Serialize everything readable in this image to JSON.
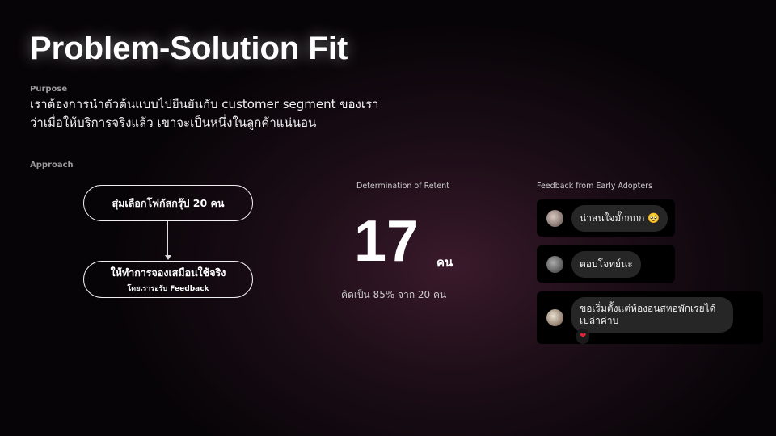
{
  "title": "Problem-Solution Fit",
  "purpose": {
    "label": "Purpose",
    "line1": "เราต้องการนำตัวต้นแบบไปยืนยันกับ customer segment ของเรา",
    "line2": "ว่าเมื่อให้บริการจริงแล้ว เขาจะเป็นหนึ่งในลูกค้าแน่นอน"
  },
  "approach": {
    "label": "Approach",
    "step1": "สุ่มเลือกโฟกัสกรุ๊ป 20 คน",
    "step2": "ให้ทำการจองเสมือนใช้จริง",
    "step2_sub": "โดยเรารอรับ Feedback"
  },
  "retention": {
    "heading": "Determination of Retent",
    "value": "17",
    "unit": "คน",
    "note": "คิดเป็น 85% จาก 20 คน",
    "percent": 85
  },
  "feedback": {
    "heading": "Feedback from Early Adopters",
    "items": [
      {
        "text": "น่าสนใจมั๊กกกก",
        "emoji": "🥺"
      },
      {
        "text": "ตอบโจทย์นะ"
      },
      {
        "text": "ขอเริ่มตั้งแต่ห้องอนสหอพักเรยได้เปล่าค่าบ",
        "reaction": "❤"
      }
    ]
  }
}
